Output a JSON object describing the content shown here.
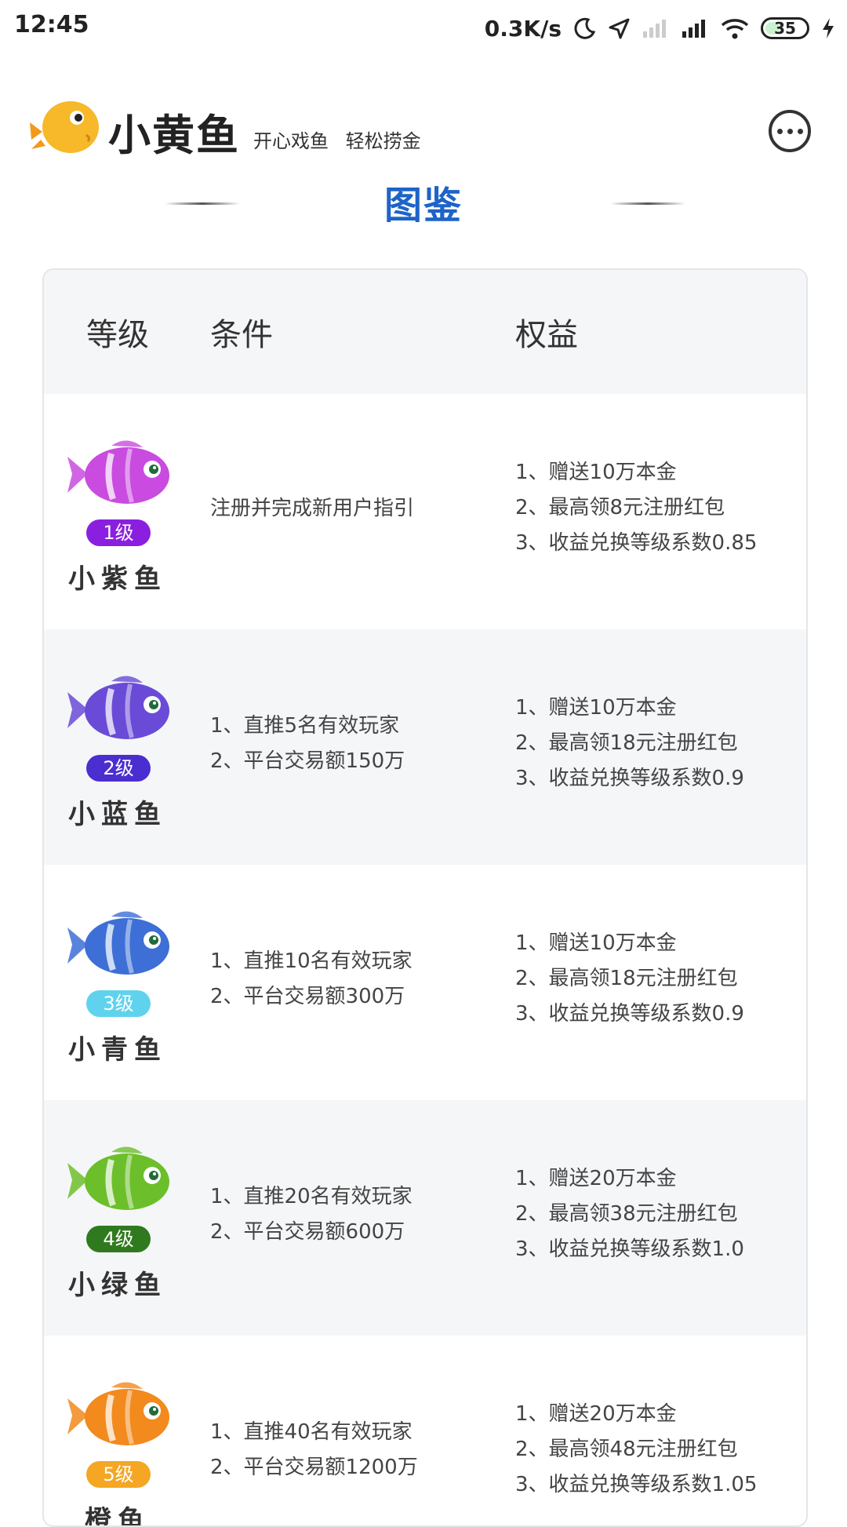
{
  "status": {
    "time": "12:45",
    "speed": "0.3K/s",
    "battery": "35"
  },
  "header": {
    "brand": "小黄鱼",
    "slogan": "开心戏鱼 轻松捞金"
  },
  "page_title": "图鉴",
  "table": {
    "headers": {
      "level": "等级",
      "condition": "条件",
      "benefit": "权益"
    },
    "rows": [
      {
        "badge": "1级",
        "name": "小紫鱼",
        "badge_color": "#8b1fe0",
        "fish_color": "#c94be0",
        "conditions": [
          "注册并完成新用户指引"
        ],
        "benefits": [
          "1、赠送10万本金",
          "2、最高领8元注册红包",
          "3、收益兑换等级系数0.85"
        ]
      },
      {
        "badge": "2级",
        "name": "小蓝鱼",
        "badge_color": "#4b2ed0",
        "fish_color": "#6a4bd8",
        "conditions": [
          "1、直推5名有效玩家",
          "2、平台交易额150万"
        ],
        "benefits": [
          "1、赠送10万本金",
          "2、最高领18元注册红包",
          "3、收益兑换等级系数0.9"
        ]
      },
      {
        "badge": "3级",
        "name": "小青鱼",
        "badge_color": "#5fd3ee",
        "fish_color": "#3d6fd6",
        "conditions": [
          "1、直推10名有效玩家",
          "2、平台交易额300万"
        ],
        "benefits": [
          "1、赠送10万本金",
          "2、最高领18元注册红包",
          "3、收益兑换等级系数0.9"
        ]
      },
      {
        "badge": "4级",
        "name": "小绿鱼",
        "badge_color": "#2f7a1e",
        "fish_color": "#6cbf2a",
        "conditions": [
          "1、直推20名有效玩家",
          "2、平台交易额600万"
        ],
        "benefits": [
          "1、赠送20万本金",
          "2、最高领38元注册红包",
          "3、收益兑换等级系数1.0"
        ]
      },
      {
        "badge": "5级",
        "name": "橙鱼",
        "badge_color": "#f5a623",
        "fish_color": "#f28a1e",
        "conditions": [
          "1、直推40名有效玩家",
          "2、平台交易额1200万"
        ],
        "benefits": [
          "1、赠送20万本金",
          "2、最高领48元注册红包",
          "3、收益兑换等级系数1.05"
        ]
      }
    ]
  }
}
